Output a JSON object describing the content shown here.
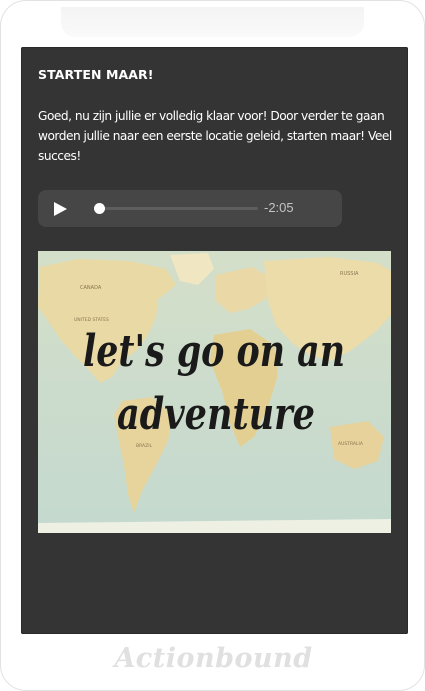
{
  "step": {
    "title": "STARTEN MAAR!",
    "text": "Goed, nu zijn jullie er volledig klaar voor! Door verder te gaan worden jullie naar een eerste locatie geleid, starten maar! Veel succes!"
  },
  "audio": {
    "play_icon": "play-icon",
    "time_remaining": "-2:05",
    "progress": 0.03
  },
  "image": {
    "line1": "let's go on an",
    "line2": "adventure",
    "map_label_canada": "CANADA",
    "map_label_us": "UNITED STATES",
    "map_label_russia": "RUSSIA",
    "map_label_brazil": "BRAZIL",
    "map_label_australia": "AUSTRALIA"
  },
  "footer": {
    "brand": "Actionbound"
  },
  "colors": {
    "screen_bg": "#343434",
    "audio_bg": "#464646",
    "map_land": "#e8d9a8",
    "map_sea": "#c9dccb",
    "script_text": "#1a1a1a"
  }
}
